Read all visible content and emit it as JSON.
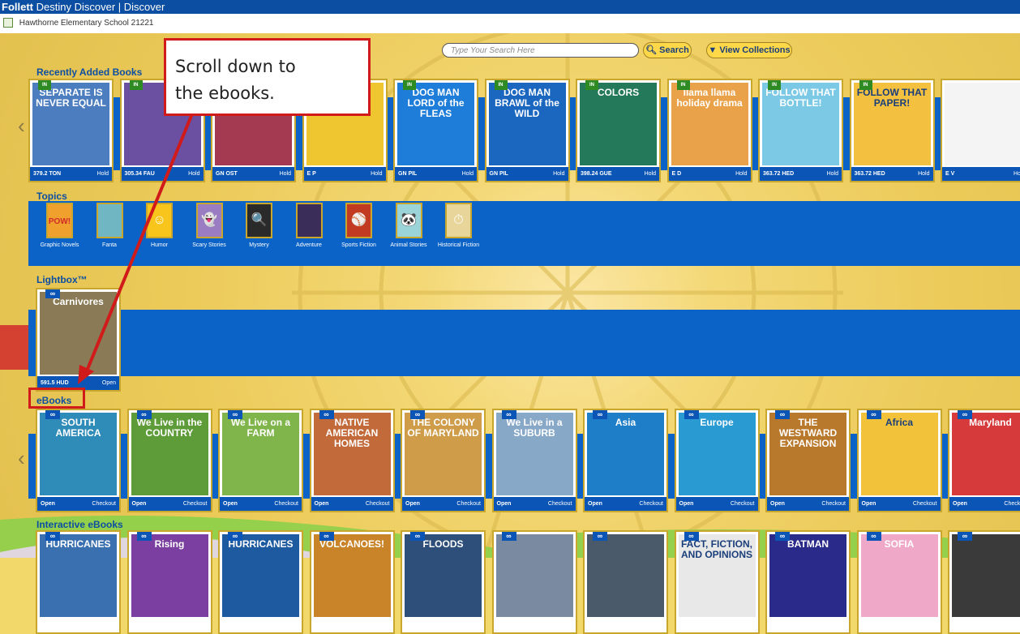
{
  "header": {
    "brand": "Follett",
    "app_title": "Destiny Discover | Discover"
  },
  "school": {
    "name": "Hawthorne Elementary School 21221"
  },
  "search": {
    "placeholder": "Type Your Search Here",
    "button": "Search",
    "collections_button": "View Collections"
  },
  "callout": {
    "line1": "Scroll down to",
    "line2": "the ebooks."
  },
  "sections": {
    "recent": {
      "title": "Recently Added Books",
      "books": [
        {
          "title": "SEPARATE IS NEVER EQUAL",
          "badge": "IN",
          "call": "379.2 TON",
          "action": "Hold",
          "color": "#4b7dbf"
        },
        {
          "title": "",
          "badge": "IN",
          "call": "305.34 FAU",
          "action": "Hold",
          "color": "#6b4fa0"
        },
        {
          "title": "",
          "badge": "",
          "call": "GN OST",
          "action": "Hold",
          "color": "#a33a52"
        },
        {
          "title": "",
          "badge": "",
          "call": "E P",
          "action": "Hold",
          "color": "#f0c630"
        },
        {
          "title": "DOG MAN LORD of the FLEAS",
          "badge": "IN",
          "call": "GN PIL",
          "action": "Hold",
          "color": "#1e7dd8"
        },
        {
          "title": "DOG MAN BRAWL of the WILD",
          "badge": "IN",
          "call": "GN PIL",
          "action": "Hold",
          "color": "#1b67c0"
        },
        {
          "title": "COLORS",
          "badge": "IN",
          "call": "398.24 GUE",
          "action": "Hold",
          "color": "#24795a"
        },
        {
          "title": "llama llama holiday drama",
          "badge": "IN",
          "call": "E D",
          "action": "Hold",
          "color": "#e9a24a"
        },
        {
          "title": "FOLLOW THAT BOTTLE!",
          "badge": "IN",
          "call": "363.72 HED",
          "action": "Hold",
          "color": "#7cc9e6"
        },
        {
          "title": "FOLLOW THAT PAPER!",
          "badge": "IN",
          "call": "363.72 HED",
          "action": "Hold",
          "color": "#f3c040"
        },
        {
          "title": "",
          "badge": "",
          "call": "E V",
          "action": "Ho",
          "color": "#f4f4f4"
        }
      ]
    },
    "topics": {
      "title": "Topics",
      "items": [
        {
          "label": "Graphic Novels",
          "color": "#f0a12d",
          "glyph": "POW!"
        },
        {
          "label": "Fanta",
          "color": "#6fb6c2",
          "glyph": ""
        },
        {
          "label": "Humor",
          "color": "#f7c51c",
          "glyph": "☺"
        },
        {
          "label": "Scary Stories",
          "color": "#9a7cc3",
          "glyph": "👻"
        },
        {
          "label": "Mystery",
          "color": "#2a2a2a",
          "glyph": "🔍"
        },
        {
          "label": "Adventure",
          "color": "#3a2d5a",
          "glyph": ""
        },
        {
          "label": "Sports Fiction",
          "color": "#c23a22",
          "glyph": "⚾"
        },
        {
          "label": "Animal Stories",
          "color": "#9ad3d8",
          "glyph": "🐼"
        },
        {
          "label": "Historical Fiction",
          "color": "#e8d59a",
          "glyph": "⏱"
        }
      ]
    },
    "lightbox": {
      "title": "Lightbox™",
      "books": [
        {
          "title": "Carnivores",
          "badge": "∞",
          "call": "591.5 HUD",
          "action": "Open",
          "color": "#8a7a55"
        }
      ]
    },
    "ebooks": {
      "title": "eBooks",
      "books": [
        {
          "title": "SOUTH AMERICA",
          "badge": "∞",
          "color": "#2f8bb8"
        },
        {
          "title": "We Live in the COUNTRY",
          "badge": "∞",
          "color": "#5e9c3a"
        },
        {
          "title": "We Live on a FARM",
          "badge": "∞",
          "color": "#7fb54a"
        },
        {
          "title": "NATIVE AMERICAN HOMES",
          "badge": "∞",
          "color": "#c26a3a"
        },
        {
          "title": "THE COLONY OF MARYLAND",
          "badge": "∞",
          "color": "#cf9d4a"
        },
        {
          "title": "We Live in a SUBURB",
          "badge": "∞",
          "color": "#88a8c8"
        },
        {
          "title": "Asia",
          "badge": "∞",
          "color": "#1f7ec8"
        },
        {
          "title": "Europe",
          "badge": "∞",
          "color": "#2a9ad2"
        },
        {
          "title": "THE WESTWARD EXPANSION",
          "badge": "∞",
          "color": "#b9792d"
        },
        {
          "title": "Africa",
          "badge": "∞",
          "color": "#f2c23a"
        },
        {
          "title": "Maryland",
          "badge": "∞",
          "color": "#d63a3a"
        }
      ],
      "open_label": "Open",
      "checkout_label": "Checkout"
    },
    "interactive": {
      "title": "Interactive eBooks",
      "books": [
        {
          "title": "HURRICANES",
          "color": "#3a6fb0"
        },
        {
          "title": "Rising",
          "color": "#7a3fa0"
        },
        {
          "title": "HURRICANES",
          "color": "#1d5aa0"
        },
        {
          "title": "VOLCANOES!",
          "color": "#c9842a"
        },
        {
          "title": "FLOODS",
          "color": "#2e4f7a"
        },
        {
          "title": "",
          "color": "#7a8aa0"
        },
        {
          "title": "",
          "color": "#4a5a6a"
        },
        {
          "title": "FACT, FICTION, AND OPINIONS",
          "color": "#e8e8e8"
        },
        {
          "title": "BATMAN",
          "color": "#2a2a8a"
        },
        {
          "title": "SOFIA",
          "color": "#f0a8c8"
        },
        {
          "title": "",
          "color": "#3a3a3a"
        }
      ]
    }
  },
  "colors": {
    "accent": "#0b4ea2",
    "shelf": "#0c63c7",
    "highlight": "#d11a1a",
    "background": "#f2d76a"
  }
}
